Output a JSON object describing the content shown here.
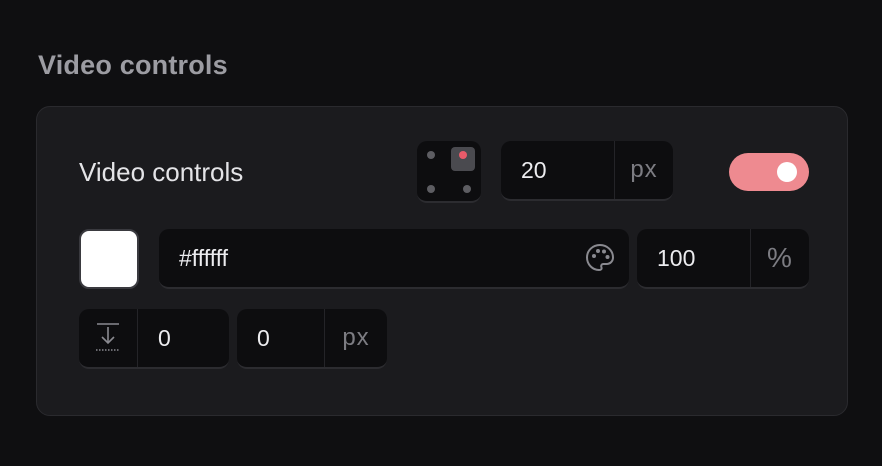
{
  "section": {
    "title": "Video controls"
  },
  "row1": {
    "label": "Video controls",
    "position": {
      "selected": "top-right"
    },
    "offset": {
      "value": "20",
      "unit": "px"
    },
    "toggle": {
      "on": true,
      "color": "#ee8a90"
    }
  },
  "row2": {
    "swatch_color": "#ffffff",
    "hex_value": "#ffffff",
    "palette_icon": "palette-icon",
    "opacity": {
      "value": "100",
      "unit": "%"
    }
  },
  "row3": {
    "align_icon": "align-bottom-icon",
    "first_value": "0",
    "second": {
      "value": "0",
      "unit": "px"
    }
  }
}
